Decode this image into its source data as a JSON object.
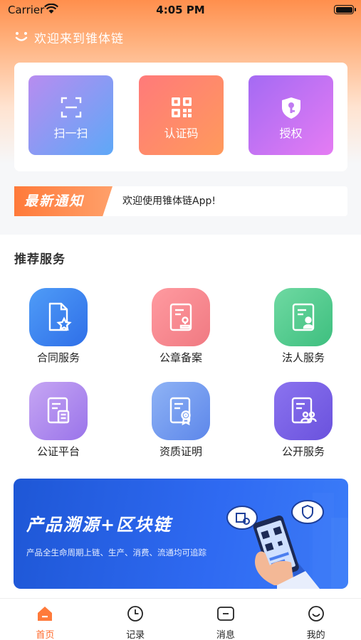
{
  "status_bar": {
    "carrier": "Carrier",
    "time": "4:05 PM"
  },
  "header": {
    "welcome": "欢迎来到锥体链"
  },
  "quick_actions": [
    {
      "label": "扫一扫",
      "icon": "scan-icon"
    },
    {
      "label": "认证码",
      "icon": "qr-code-icon"
    },
    {
      "label": "授权",
      "icon": "key-shield-icon"
    }
  ],
  "notice": {
    "tag": "最新通知",
    "text": "欢迎使用锥体链App!"
  },
  "recommended": {
    "title": "推荐服务",
    "items": [
      {
        "label": "合同服务",
        "icon": "contract-star-icon",
        "color": "#3a82f0"
      },
      {
        "label": "公章备案",
        "icon": "seal-document-icon",
        "color": "#f48a90"
      },
      {
        "label": "法人服务",
        "icon": "person-document-icon",
        "color": "#4fcb8c"
      },
      {
        "label": "公证平台",
        "icon": "notary-document-icon",
        "color": "#ad8af0"
      },
      {
        "label": "资质证明",
        "icon": "certificate-document-icon",
        "color": "#759cf0"
      },
      {
        "label": "公开服务",
        "icon": "group-document-icon",
        "color": "#7a62e6"
      }
    ]
  },
  "banner": {
    "title": "产品溯源+区块链",
    "subtitle": "产品全生命周期上链、生产、消费、流通均可追踪"
  },
  "tabbar": {
    "items": [
      {
        "label": "首页",
        "icon": "home-icon",
        "active": true
      },
      {
        "label": "记录",
        "icon": "clock-icon",
        "active": false
      },
      {
        "label": "消息",
        "icon": "message-icon",
        "active": false
      },
      {
        "label": "我的",
        "icon": "smiley-profile-icon",
        "active": false
      }
    ]
  },
  "colors": {
    "accent": "#ff6a2b",
    "header_orange": "#ff8f4d",
    "banner_blue": "#2f6af2"
  }
}
